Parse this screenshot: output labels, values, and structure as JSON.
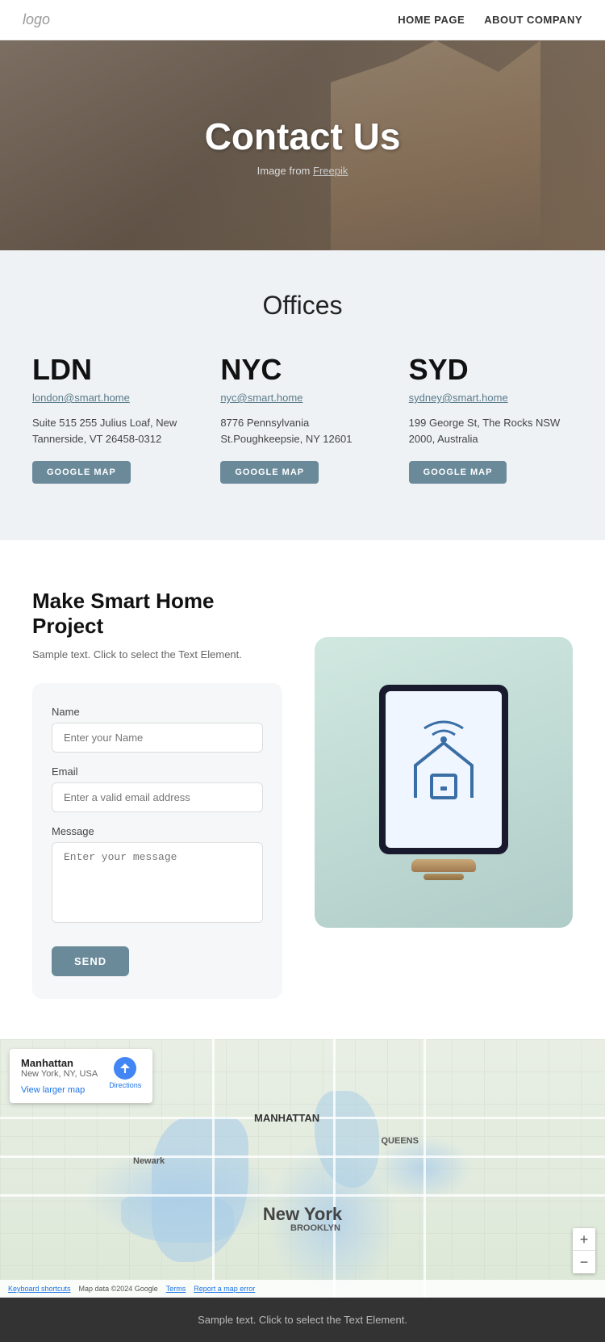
{
  "nav": {
    "logo": "logo",
    "links": [
      {
        "label": "HOME PAGE",
        "href": "#"
      },
      {
        "label": "ABOUT COMPANY",
        "href": "#"
      }
    ]
  },
  "hero": {
    "title": "Contact Us",
    "subtitle": "Image from Freepik",
    "subtitle_link": "Freepik"
  },
  "offices": {
    "section_title": "Offices",
    "items": [
      {
        "code": "LDN",
        "email": "london@smart.home",
        "address": "Suite 515 255 Julius Loaf, New Tannerside, VT 26458-0312",
        "map_btn": "GOOGLE MAP"
      },
      {
        "code": "NYC",
        "email": "nyc@smart.home",
        "address": "8776 Pennsylvania St.Poughkeepsie, NY 12601",
        "map_btn": "GOOGLE MAP"
      },
      {
        "code": "SYD",
        "email": "sydney@smart.home",
        "address": "199 George St, The Rocks NSW 2000, Australia",
        "map_btn": "GOOGLE MAP"
      }
    ]
  },
  "project": {
    "title": "Make Smart Home Project",
    "subtitle": "Sample text. Click to select the Text Element.",
    "form": {
      "name_label": "Name",
      "name_placeholder": "Enter your Name",
      "email_label": "Email",
      "email_placeholder": "Enter a valid email address",
      "message_label": "Message",
      "message_placeholder": "Enter your message",
      "send_btn": "SEND"
    }
  },
  "map": {
    "location_title": "Manhattan",
    "location_sub": "New York, NY, USA",
    "view_larger": "View larger map",
    "directions_label": "Directions",
    "zoom_in": "+",
    "zoom_out": "−",
    "attribution": "Map data ©2024 Google",
    "labels": {
      "new_york": "New York",
      "manhattan": "MANHATTAN",
      "queens": "QUEENS",
      "brooklyn": "BROOKLYN",
      "newark": "Newark"
    },
    "bottom_links": [
      "Keyboard shortcuts",
      "Map data ©2024 Google",
      "Terms",
      "Report a map error"
    ]
  },
  "footer": {
    "text": "Sample text. Click to select the Text Element."
  }
}
